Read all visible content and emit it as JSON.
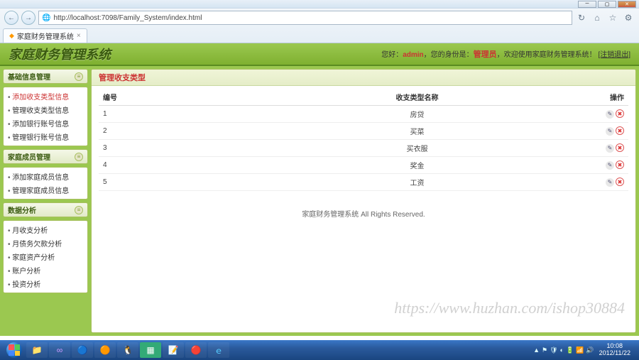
{
  "browser": {
    "url": "http://localhost:7098/Family_System/index.html",
    "tab_title": "家庭财务管理系统"
  },
  "header": {
    "app_title": "家庭财务管理系统",
    "greeting_prefix": "您好：",
    "username": "admin",
    "role_prefix": "，您的身份是：",
    "role": "管理员",
    "welcome": "，欢迎使用家庭财务管理系统！",
    "logout": "[注销退出]"
  },
  "sidebar": {
    "group1": {
      "title": "基础信息管理",
      "items": [
        "添加收支类型信息",
        "管理收支类型信息",
        "添加银行账号信息",
        "管理银行账号信息"
      ]
    },
    "group2": {
      "title": "家庭成员管理",
      "items": [
        "添加家庭成员信息",
        "管理家庭成员信息"
      ]
    },
    "group3": {
      "title": "数据分析",
      "items": [
        "月收支分析",
        "月债务欠款分析",
        "家庭资产分析",
        "账户分析",
        "投资分析"
      ]
    }
  },
  "content": {
    "title": "管理收支类型",
    "columns": [
      "编号",
      "收支类型名称",
      "操作"
    ],
    "rows": [
      {
        "id": "1",
        "name": "房贷"
      },
      {
        "id": "2",
        "name": "买菜"
      },
      {
        "id": "3",
        "name": "买衣服"
      },
      {
        "id": "4",
        "name": "奖金"
      },
      {
        "id": "5",
        "name": "工资"
      }
    ],
    "footer": "家庭财务管理系统 All Rights Reserved."
  },
  "watermark": "https://www.huzhan.com/ishop30884",
  "taskbar": {
    "time": "10:08",
    "date": "2012/11/22"
  }
}
